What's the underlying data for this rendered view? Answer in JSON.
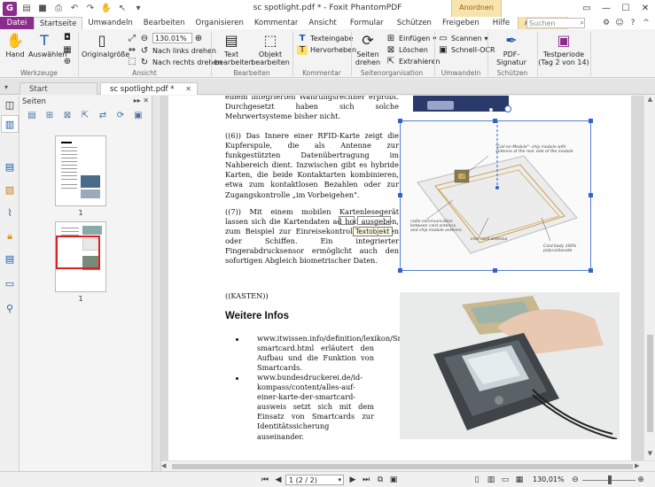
{
  "titlebar": {
    "app_logo": "G",
    "title": "sc spotlight.pdf * - Foxit PhantomPDF",
    "context_tab_group": "Anordnen"
  },
  "tabs": {
    "items": [
      "Datei",
      "Startseite",
      "Umwandeln",
      "Bearbeiten",
      "Organisieren",
      "Kommentar",
      "Ansicht",
      "Formular",
      "Schützen",
      "Freigeben",
      "Hilfe",
      "Anordnen"
    ],
    "search_placeholder": "Suchen"
  },
  "ribbon": {
    "hand": "Hand",
    "auswaehlen": "Auswählen",
    "werkzeuge": "Werkzeuge",
    "originalgroesse": "Originalgröße",
    "zoom_value": "130.01%",
    "nach_links": "Nach links drehen",
    "nach_rechts": "Nach rechts drehen",
    "ansicht": "Ansicht",
    "text_bearbeiten": [
      "Text",
      "bearbeiten"
    ],
    "objekt_bearbeiten": [
      "Objekt",
      "bearbeiten"
    ],
    "bearbeiten": "Bearbeiten",
    "textergabe": "Texteingabe",
    "hervorheben": "Hervorheben",
    "kommentar": "Kommentar",
    "seiten_drehen": [
      "Seiten",
      "drehen"
    ],
    "einfuegen": "Einfügen",
    "loeschen": "Löschen",
    "extrahieren": "Extrahieren",
    "seitenorganisation": "Seitenorganisation",
    "scannen": "Scannen",
    "schnell_ocr": "Schnell-OCR",
    "umwandeln": "Umwandeln",
    "pdf_signatur": "PDF-Signatur",
    "schuetzen": "Schützen",
    "testperiode": [
      "Testperiode",
      "(Tag 2 von 14)"
    ]
  },
  "doc_tabs": {
    "start": "Start",
    "file": "sc spotlight.pdf *"
  },
  "pages_panel": {
    "title": "Seiten",
    "thumb1_label": "1",
    "thumb2_label": "1"
  },
  "page": {
    "para0": "einem integrierten Wahrungsrechner erprobt. Durchgesetzt haben sich solche Mehrwertsysteme bisher nicht.",
    "para1": "((6)) Das Innere einer RFID-Karte zeigt die Kupferspule, die als Antenne zur funkgestützten Datenübertragung im Nahbereich dient. Inzwischen gibt es hybride Karten, die beide Kontaktarten kombinieren, etwa zum kontaktlosen Bezahlen oder zur Zugangskontrolle „im Vorbeigehen\".",
    "para2": "((7)) Mit einem mobilen Kartenlesegerät lassen sich die Kartendaten ad hoc ausgeben, zum Beispiel zur Einreisekontrolle in Zügen oder Schiffen. Ein integrierter Fingerabdrucksensor ermöglicht auch den sofortigen Abgleich biometrischer Daten.",
    "kasten": "((KASTEN))",
    "heading": "Weitere Infos",
    "bullet1": "www.itwissen.info/definition/lexikon/Smartcard-smartcard.html erläutert den Aufbau und die Funktion von Smartcards.",
    "bullet2": "www.bundesdruckerei.de/id-kompass/content/alles-auf-einer-karte-der-smartcard-ausweis setzt sich mit dem Einsatz von Smartcards zur Identitätssicherung auseinander.",
    "tooltip": "Textobjekt",
    "card_labels": [
      "\"Coil-on-Module\"- chip module with antenna at the rear side of the module",
      "radio communication between card antenna and chip module antenna",
      "inlet card antenna",
      "Card body 100% polycarbonate"
    ]
  },
  "statusbar": {
    "page_value": "1 (2 / 2)",
    "zoom": "130,01%"
  },
  "colors": {
    "accent": "#8b2b8b",
    "context_tab": "#f6e3b0",
    "selection": "#3264c8"
  }
}
